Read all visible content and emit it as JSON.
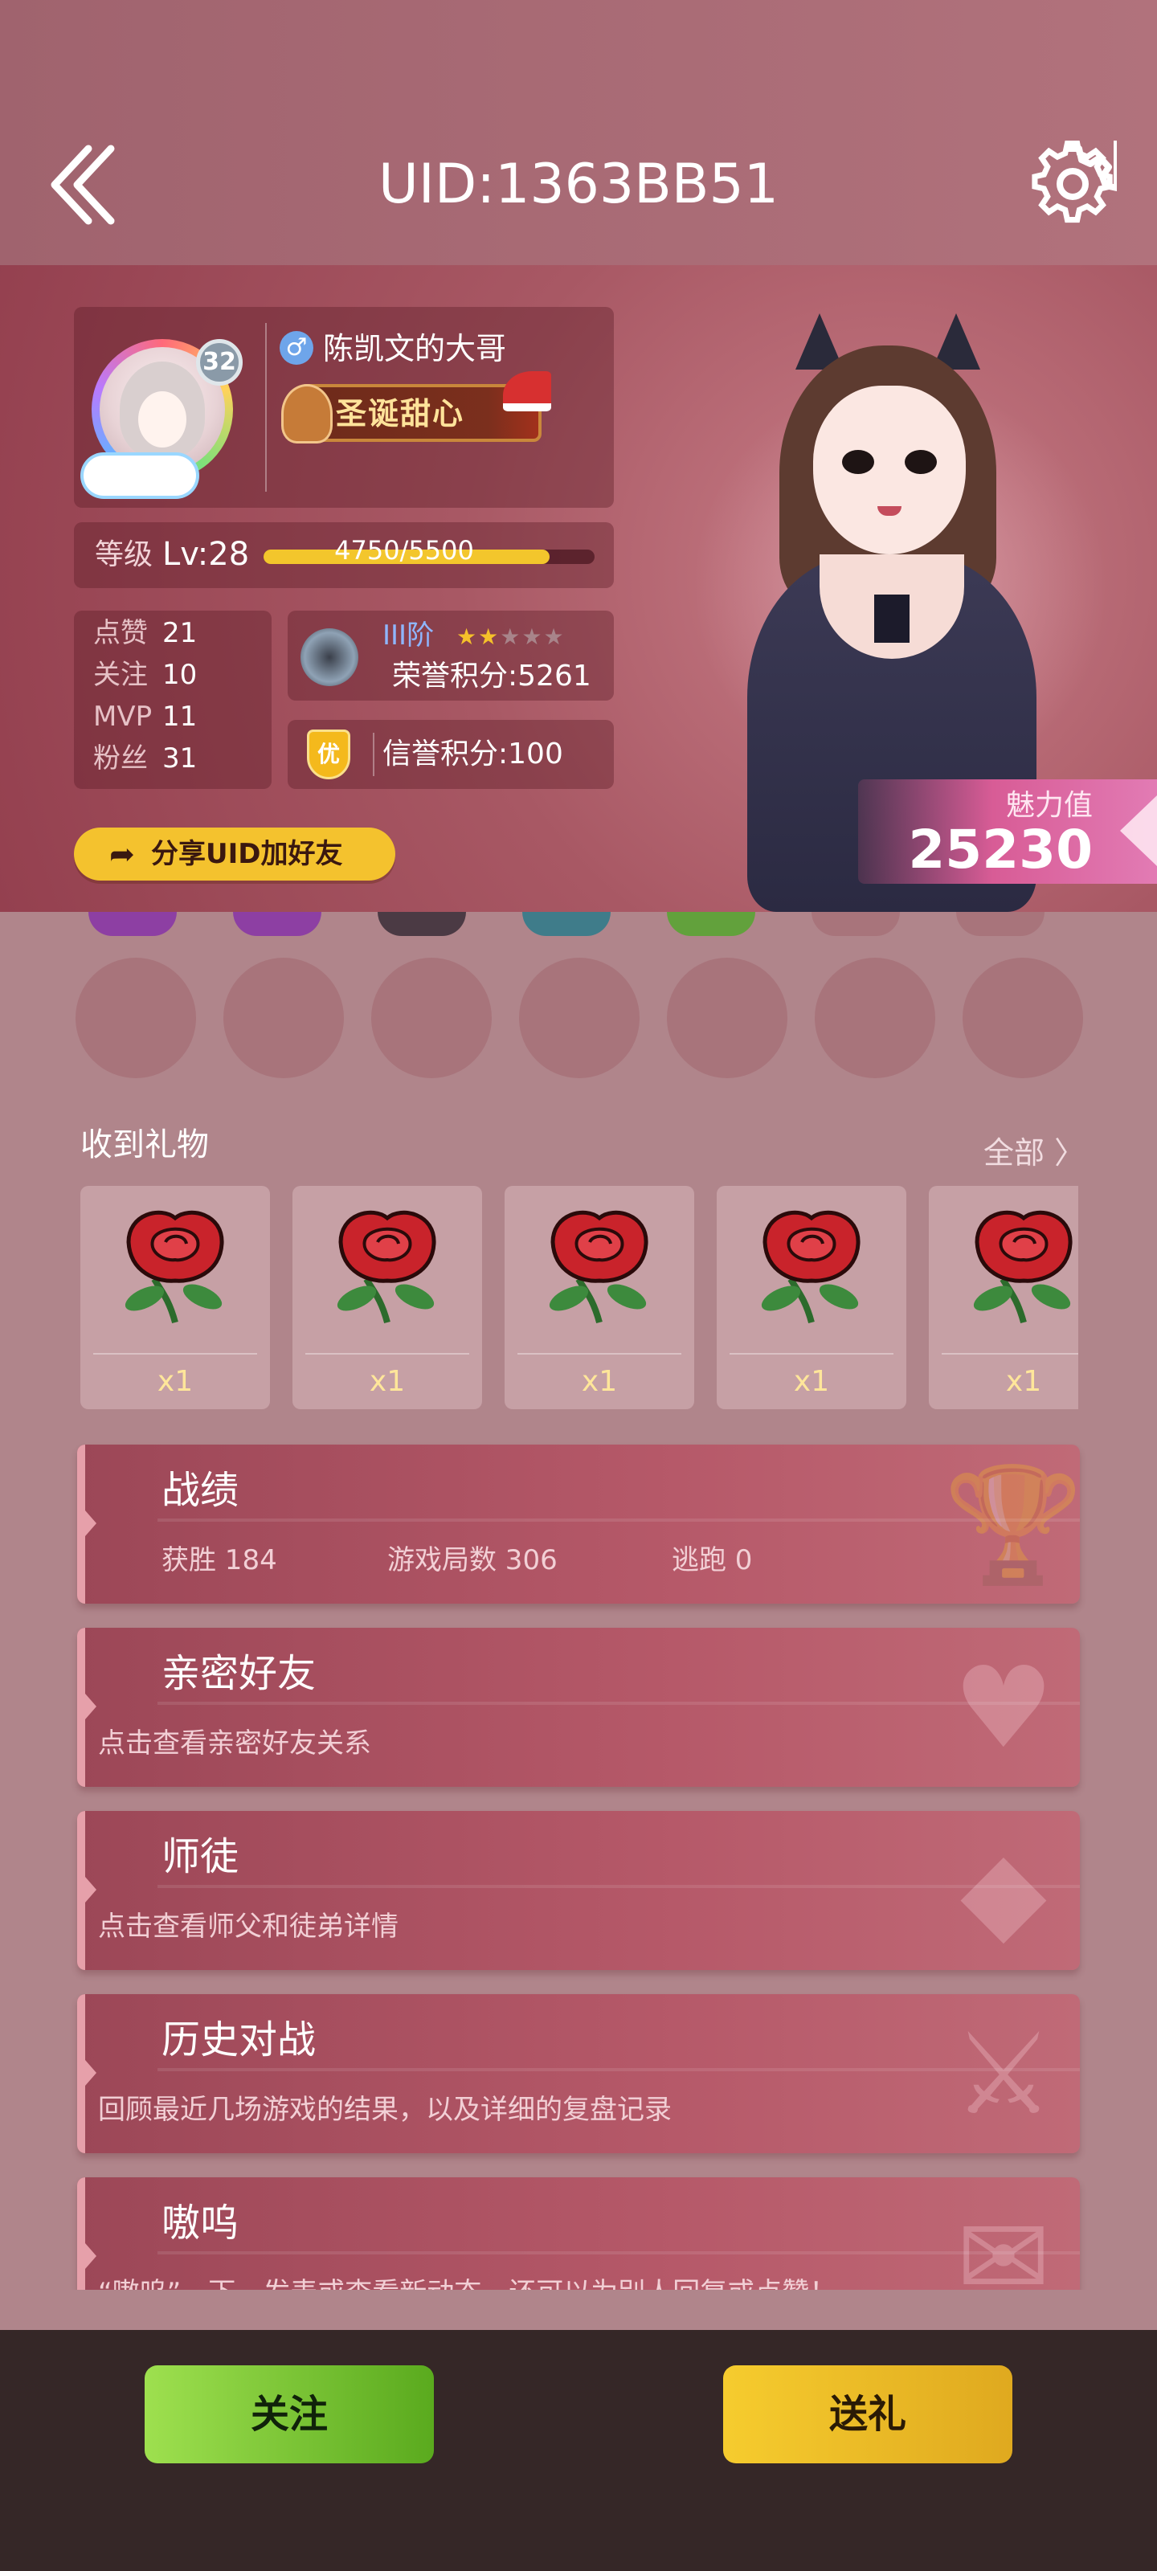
{
  "header": {
    "title": "UID:1363BB51",
    "back_icon": "double-chevron-left-icon",
    "settings_icon": "gear-icon"
  },
  "profile": {
    "avatar_level": "32",
    "gender_symbol": "♂",
    "nickname": "陈凯文的大哥",
    "title_badge": "圣诞甜心",
    "level_label": "等级",
    "level_value": "Lv:28",
    "level_progress_text": "4750/5500",
    "level_progress_fraction": 0.8636,
    "stats": [
      {
        "label": "点赞",
        "value": "21"
      },
      {
        "label": "关注",
        "value": "10"
      },
      {
        "label": "MVP",
        "value": "11"
      },
      {
        "label": "粉丝",
        "value": "31"
      }
    ],
    "rank_tier": "III阶",
    "rank_stars_filled": 2,
    "rank_stars_total": 5,
    "honor_points": "荣誉积分:5261",
    "credit_icon_text": "优",
    "credit_points": "信誉积分:100",
    "share_label": "分享UID加好友",
    "share_icon": "share-arrow-icon",
    "charm_label": "魅力值",
    "charm_value": "25230"
  },
  "badges": {
    "empty_slots": 7
  },
  "gifts": {
    "title": "收到礼物",
    "view_all": "全部 〉",
    "items": [
      {
        "icon": "rose-icon",
        "count": "x1"
      },
      {
        "icon": "rose-icon",
        "count": "x1"
      },
      {
        "icon": "rose-icon",
        "count": "x1"
      },
      {
        "icon": "rose-icon",
        "count": "x1"
      },
      {
        "icon": "rose-icon",
        "count": "x1"
      }
    ]
  },
  "menu": {
    "record": {
      "title": "战绩",
      "wins": "获胜 184",
      "games": "游戏局数 306",
      "escapes": "逃跑 0",
      "icon": "trophy-icon"
    },
    "friends": {
      "title": "亲密好友",
      "desc": "点击查看亲密好友关系",
      "icon": "heart-icon"
    },
    "mentor": {
      "title": "师徒",
      "desc": "点击查看师父和徒弟详情",
      "icon": "fox-mask-icon"
    },
    "history": {
      "title": "历史对战",
      "desc": "回顾最近几场游戏的结果，以及详细的复盘记录",
      "icon": "sword-icon"
    },
    "howl": {
      "title": "嗷呜",
      "desc": "“嗷呜”一下，发表或查看新动态，还可以为别人回复或点赞！",
      "icon": "note-heart-icon"
    }
  },
  "bottom": {
    "follow_label": "关注",
    "gift_label": "送礼"
  },
  "colors": {
    "accent_yellow": "#f4c22e",
    "follow_green": "#6cbf2a",
    "card_rose": "#b65969",
    "charm_pink": "#d85c96"
  }
}
